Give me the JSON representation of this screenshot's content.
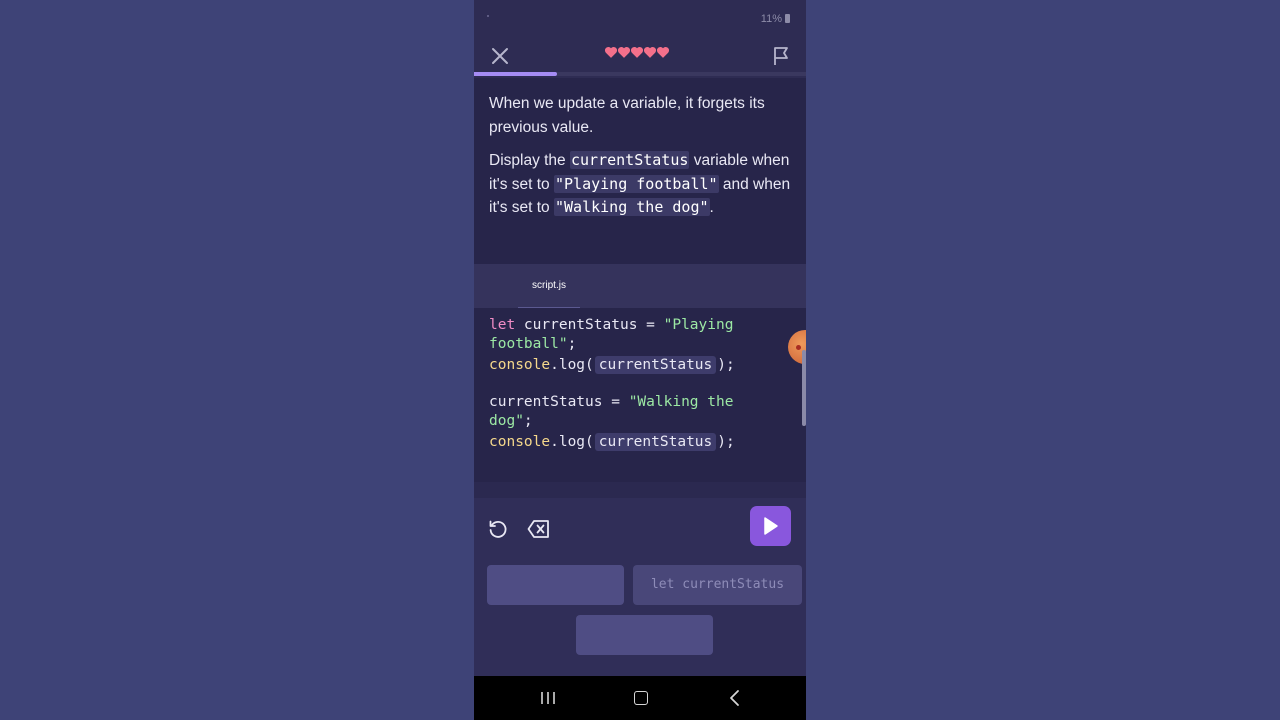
{
  "status_bar": {
    "battery": "11%"
  },
  "lesson": {
    "hearts": 5,
    "progress": 0.25,
    "instruction_line1": "When we update a variable, it forgets its previous value.",
    "instruction_line2": {
      "t1": "Display the ",
      "code1": "currentStatus",
      "t2": " variable when it's set to ",
      "code2": "\"Playing football\"",
      "t3": " and when it's set to ",
      "code3": "\"Walking the dog\"",
      "t4": "."
    }
  },
  "editor": {
    "file_tab": "script.js",
    "line1": {
      "kw": "let",
      "text": " currentStatus = ",
      "str_a": "\"Playing",
      "str_b": "football\"",
      "semi": ";"
    },
    "line2": {
      "fn": "console",
      "text": ".log(",
      "slot": "currentStatus",
      "close": ");"
    },
    "line3": {
      "text": "currentStatus = ",
      "str_a": "\"Walking the",
      "str_b": "dog\"",
      "semi": ";"
    },
    "line4": {
      "fn": "console",
      "text": ".log(",
      "slot": "currentStatus",
      "close": ");"
    }
  },
  "options": [
    "",
    "let currentStatus",
    ""
  ],
  "colors": {
    "accent": "#8957dd",
    "progress": "#a58cf4",
    "heart": "#f4708b"
  }
}
